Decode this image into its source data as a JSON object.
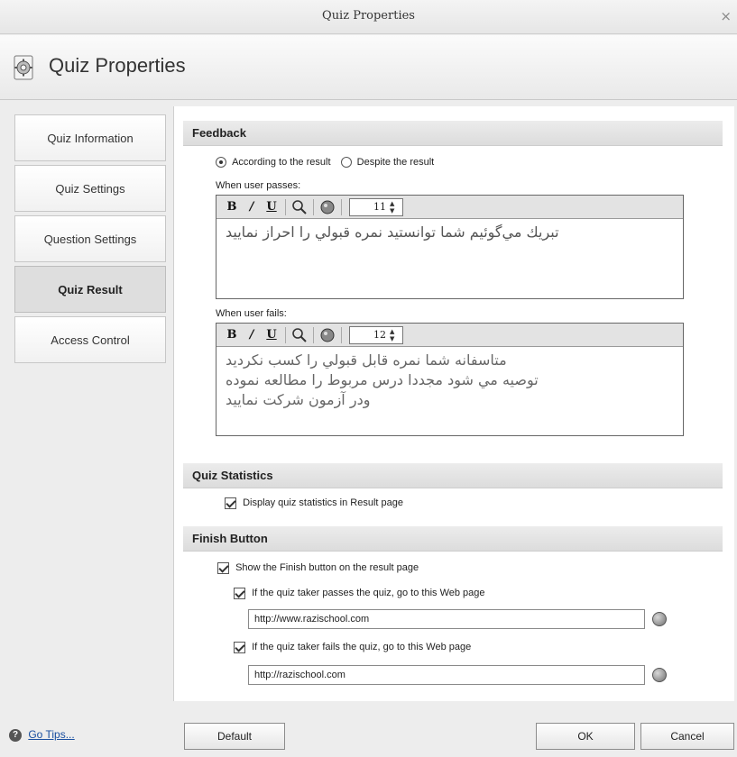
{
  "window": {
    "title": "Quiz Properties",
    "close_glyph": "×"
  },
  "header": {
    "title": "Quiz Properties",
    "icon": "gear-document-icon"
  },
  "sidebar": {
    "items": [
      {
        "label": "Quiz Information",
        "active": false
      },
      {
        "label": "Quiz Settings",
        "active": false
      },
      {
        "label": "Question Settings",
        "active": false
      },
      {
        "label": "Quiz Result",
        "active": true
      },
      {
        "label": "Access Control",
        "active": false
      }
    ]
  },
  "feedback": {
    "heading": "Feedback",
    "radio_according": "According to the result",
    "radio_despite": "Despite the result",
    "selected": "According to the result",
    "pass_label": "When user passes:",
    "pass_font_size": "11",
    "pass_text": "تبريك مي‌گوئيم شما توانستيد نمره قبولي را احراز نماييد",
    "fail_label": "When user fails:",
    "fail_font_size": "12",
    "fail_text_1": "متاسفانه شما نمره قابل قبولي را كسب نكرديد",
    "fail_text_2": "توصيه مي شود مجددا درس مربوط را مطالعه نموده",
    "fail_text_3": "ودر آزمون شركت نماييد",
    "toolbar": {
      "bold": "B",
      "italic": "/",
      "underline": "U"
    }
  },
  "statistics": {
    "heading": "Quiz Statistics",
    "display_label": "Display quiz statistics in Result page",
    "display_checked": true
  },
  "finish": {
    "heading": "Finish Button",
    "show_label": "Show the Finish button on the result page",
    "show_checked": true,
    "pass_label": "If the quiz taker passes the quiz, go to this Web page",
    "pass_checked": true,
    "pass_url": "http://www.razischool.com",
    "fail_label": "If the quiz taker fails the quiz, go to this Web page",
    "fail_checked": true,
    "fail_url": "http://razischool.com"
  },
  "footer": {
    "tips_label": "Go Tips...",
    "default_label": "Default",
    "ok_label": "OK",
    "cancel_label": "Cancel"
  }
}
